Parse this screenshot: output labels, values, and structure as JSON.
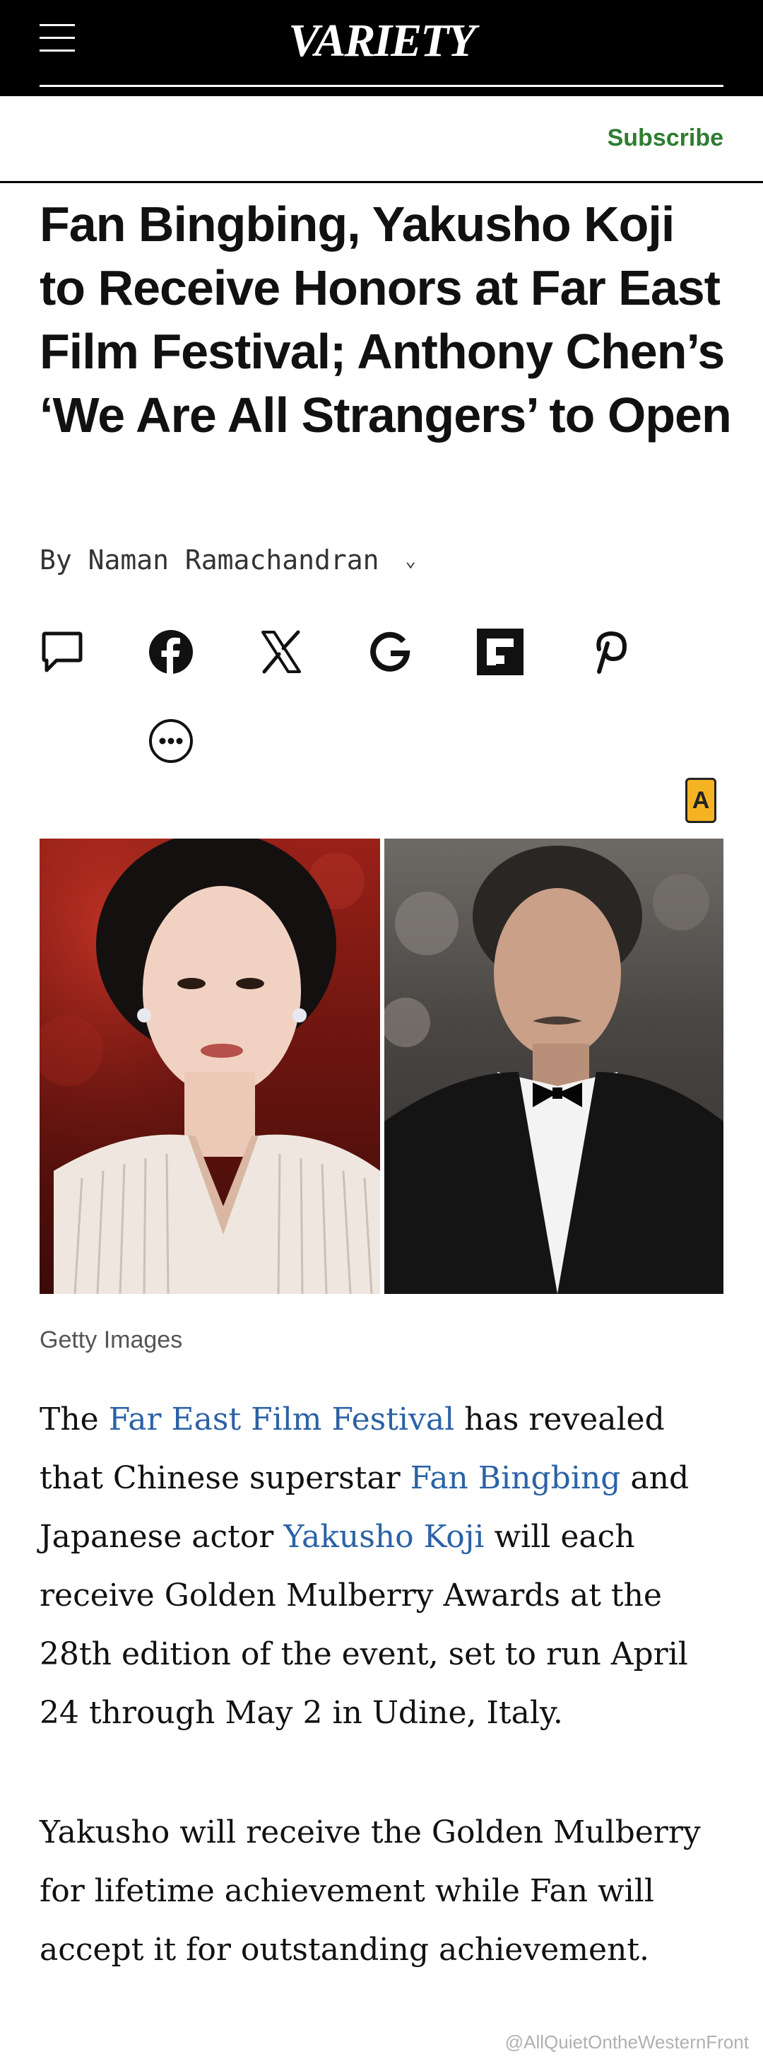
{
  "header": {
    "logo_text": "VARIETY",
    "subscribe_label": "Subscribe"
  },
  "article": {
    "headline": "Fan Bingbing, Yakusho Koji to Receive Honors at Far East Film Festival; Anthony Chen’s ‘We Are All Strangers’ to Open",
    "byline_prefix": "By",
    "author": "Naman Ramachandran",
    "image_caption": "Getty Images",
    "paragraph1": {
      "t1": "The ",
      "link1": "Far East Film Festival",
      "t2": " has revealed that Chinese superstar ",
      "link2": "Fan Bingbing",
      "t3": " and Japanese actor ",
      "link3": "Yakusho Koji",
      "t4": " will each receive Golden Mulberry Awards at the 28th edition of the event, set to run April 24 through May 2 in Udine, Italy."
    },
    "paragraph2": "Yakusho will receive the Golden Mulberry for lifetime achievement while Fan will accept it for outstanding achievement."
  },
  "share_icons": [
    "comment-icon",
    "facebook-icon",
    "x-icon",
    "google-icon",
    "flipboard-icon",
    "pinterest-icon",
    "more-icon"
  ],
  "ad_badge": "A",
  "watermark": "@AllQuietOntheWesternFront",
  "colors": {
    "header_bg": "#000000",
    "subscribe": "#2e7d32",
    "link": "#2b62a6",
    "ad_badge": "#f5b324"
  }
}
